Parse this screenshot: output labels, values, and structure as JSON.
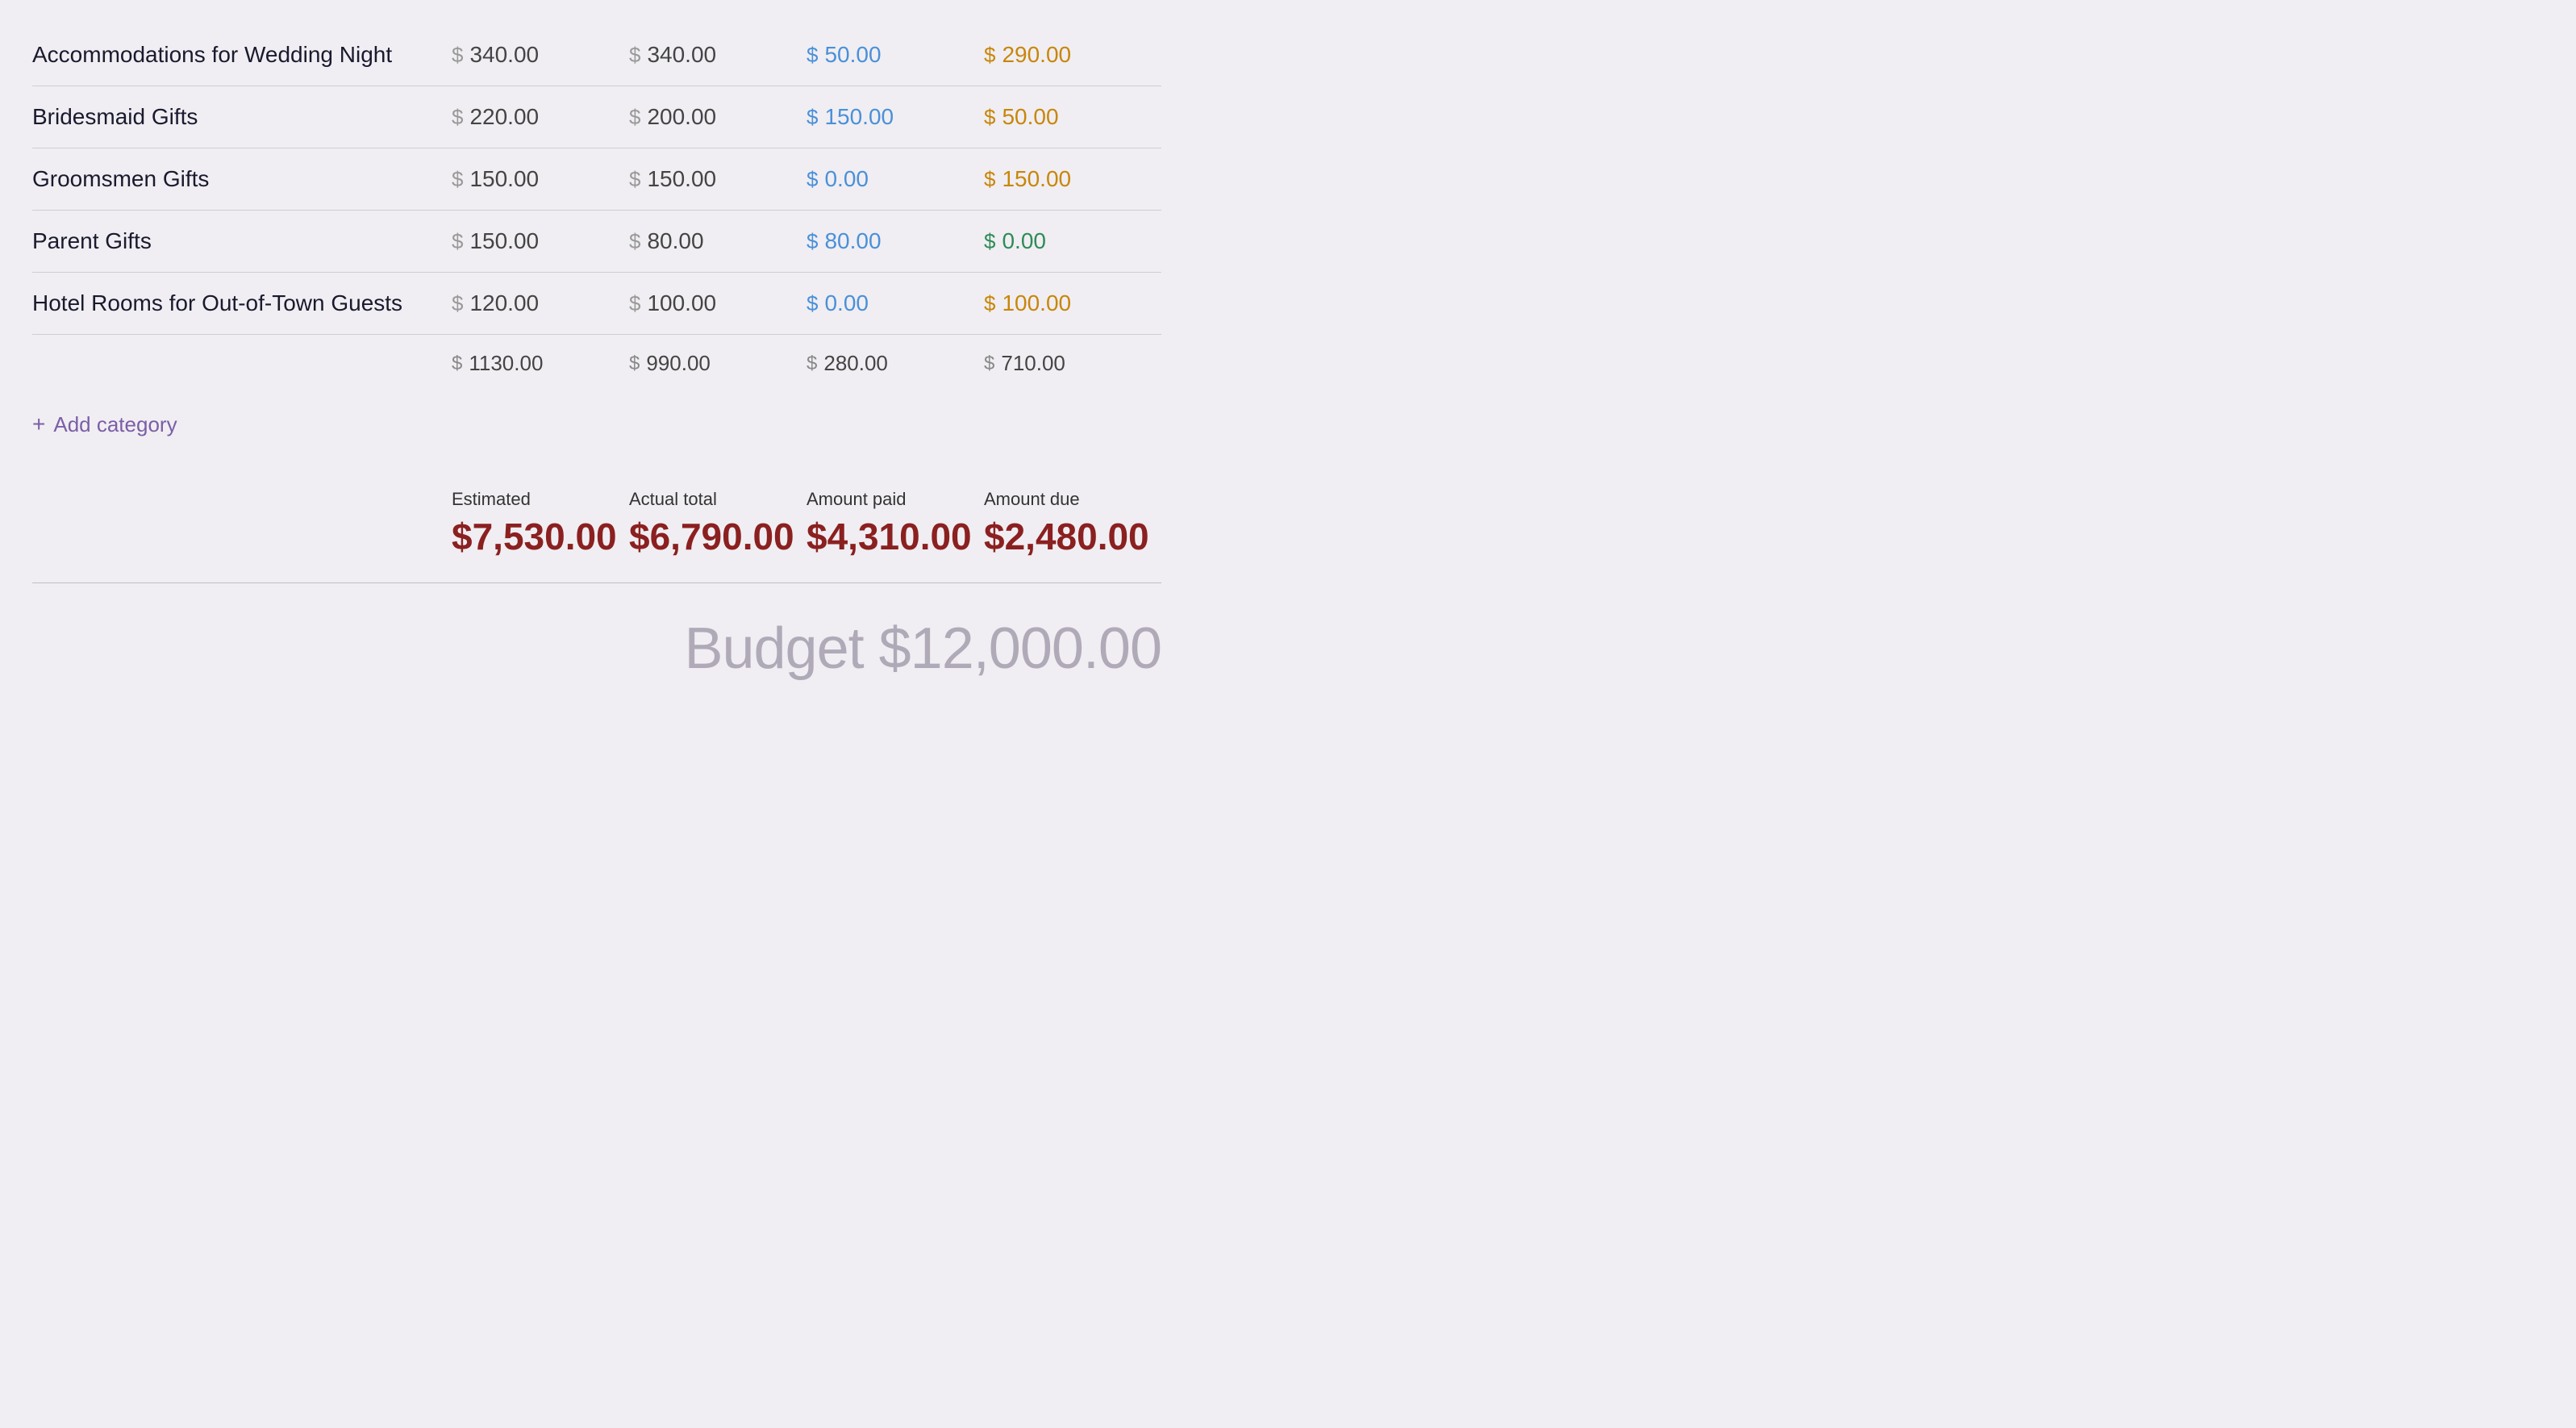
{
  "colors": {
    "accent_purple": "#7b5ea7",
    "amount_paid": "#4a90d9",
    "amount_due_orange": "#c8860a",
    "amount_due_green": "#2e8b57",
    "total_red": "#8b2020",
    "budget_gray": "#b0aab8"
  },
  "rows": [
    {
      "name": "Accommodations for Wedding Night",
      "estimated": "340.00",
      "actual": "340.00",
      "paid": "50.00",
      "due": "290.00",
      "due_color": "orange"
    },
    {
      "name": "Bridesmaid Gifts",
      "estimated": "220.00",
      "actual": "200.00",
      "paid": "150.00",
      "due": "50.00",
      "due_color": "orange"
    },
    {
      "name": "Groomsmen Gifts",
      "estimated": "150.00",
      "actual": "150.00",
      "paid": "0.00",
      "due": "150.00",
      "due_color": "orange"
    },
    {
      "name": "Parent Gifts",
      "estimated": "150.00",
      "actual": "80.00",
      "paid": "80.00",
      "due": "0.00",
      "due_color": "green"
    },
    {
      "name": "Hotel Rooms for Out-of-Town Guests",
      "estimated": "120.00",
      "actual": "100.00",
      "paid": "0.00",
      "due": "100.00",
      "due_color": "orange"
    }
  ],
  "subtotals": {
    "estimated": "1130.00",
    "actual": "990.00",
    "paid": "280.00",
    "due": "710.00"
  },
  "add_category_label": "Add category",
  "summary": {
    "estimated_label": "Estimated",
    "estimated_value": "$7,530.00",
    "actual_label": "Actual total",
    "actual_value": "$6,790.00",
    "paid_label": "Amount paid",
    "paid_value": "$4,310.00",
    "due_label": "Amount due",
    "due_value": "$2,480.00"
  },
  "budget_total": "Budget $12,000.00",
  "dollar_sign": "$"
}
